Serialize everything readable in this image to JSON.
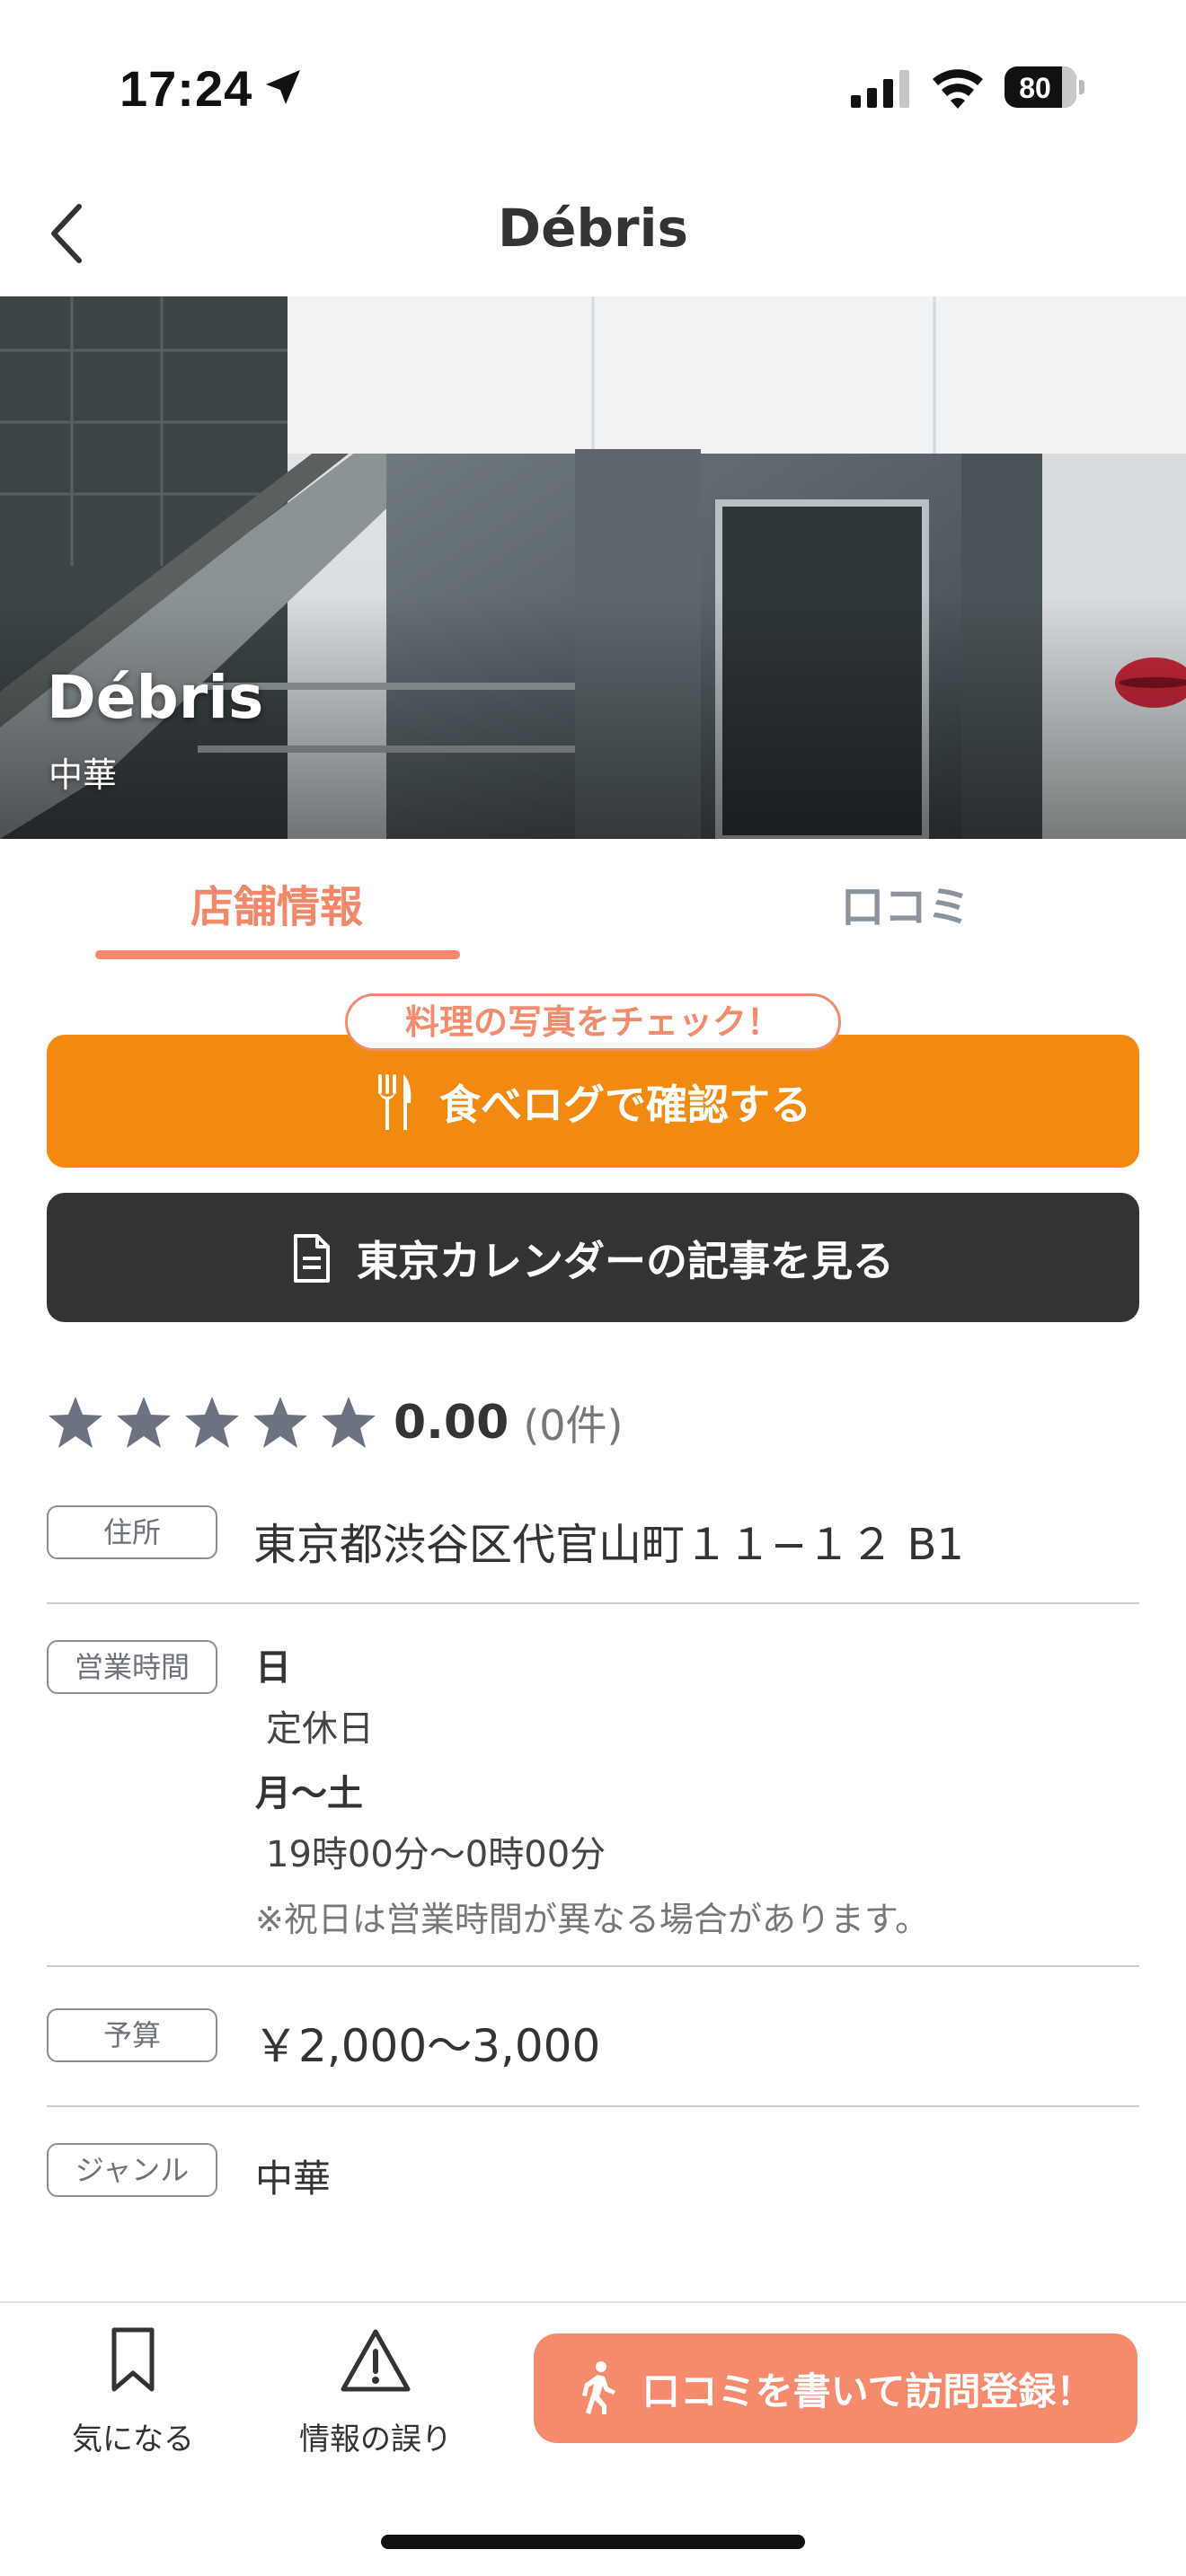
{
  "status_bar": {
    "time": "17:24",
    "battery": "80"
  },
  "header": {
    "title": "Débris",
    "back_icon": "chevron-left-icon"
  },
  "hero": {
    "name": "Débris",
    "genre": "中華"
  },
  "tabs": [
    {
      "label": "店舗情報",
      "active": true
    },
    {
      "label": "口コミ",
      "active": false
    }
  ],
  "actions": {
    "badge": "料理の写真をチェック！",
    "tabelog_label": "食べログで確認する",
    "tabelog_icon": "fork-knife-icon",
    "article_label": "東京カレンダーの記事を見る",
    "article_icon": "document-icon"
  },
  "rating": {
    "score": "0.00",
    "count": "(0件)",
    "stars_filled": 0,
    "stars_total": 5
  },
  "info": {
    "address_label": "住所",
    "address": "東京都渋谷区代官山町１１−１２ B1",
    "hours_label": "営業時間",
    "hours": [
      {
        "day": "日",
        "time": "定休日"
      },
      {
        "day": "月〜土",
        "time": "19時00分〜0時00分"
      }
    ],
    "hours_note": "※祝日は営業時間が異なる場合があります。",
    "budget_label": "予算",
    "budget": "￥2,000〜3,000",
    "genre_label": "ジャンル",
    "genre": "中華"
  },
  "bottom_bar": {
    "favorite_label": "気になる",
    "error_label": "情報の誤り",
    "visit_label": "口コミを書いて訪問登録！"
  },
  "colors": {
    "accent": "#f4876c",
    "tabelog": "#f28a12",
    "dark_button": "#333333",
    "star": "#6b7280"
  }
}
